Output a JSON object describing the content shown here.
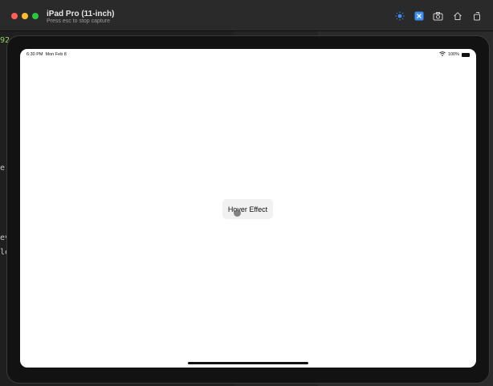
{
  "window": {
    "title": "iPad Pro (11-inch)",
    "subtitle": "Press esc to stop capture"
  },
  "toolbar": {
    "icons": [
      "appearance-icon",
      "xcode-icon",
      "screenshot-icon",
      "home-icon",
      "rotate-icon"
    ]
  },
  "background_editor": {
    "fragments": [
      "92",
      "e",
      "ev",
      "le"
    ]
  },
  "statusbar": {
    "time": "6:30 PM",
    "date": "Mon Feb 8",
    "battery": "100%"
  },
  "app": {
    "button_label": "Hover Effect"
  },
  "colors": {
    "close": "#ff5f57",
    "minimize": "#febc2e",
    "maximize": "#28c840",
    "accent": "#3b8ef5"
  }
}
